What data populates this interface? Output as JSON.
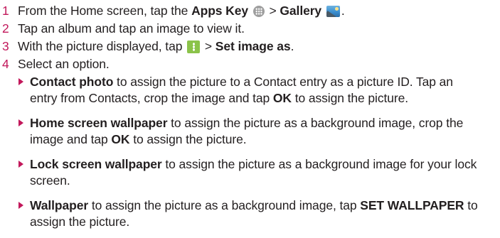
{
  "steps": [
    {
      "number": "1",
      "text_a": "From the Home screen, tap the ",
      "bold_a": "Apps Key",
      "text_b": " > ",
      "bold_b": "Gallery",
      "text_c": "."
    },
    {
      "number": "2",
      "text_a": "Tap an album and tap an image to view it."
    },
    {
      "number": "3",
      "text_a": "With the picture displayed, tap ",
      "text_b": " > ",
      "bold_b": "Set image as",
      "text_c": "."
    },
    {
      "number": "4",
      "text_a": "Select an option."
    }
  ],
  "options": [
    {
      "bold": "Contact photo",
      "line1": " to assign the picture to a Contact entry as a picture ID. Tap an",
      "line2_a": "entry from Contacts, crop the image and tap ",
      "line2_bold": "OK",
      "line2_b": " to assign the picture."
    },
    {
      "bold": "Home screen wallpaper",
      "line1": " to assign the picture as a background image, crop the",
      "line2_a": "image and tap ",
      "line2_bold": "OK",
      "line2_b": " to assign the picture."
    },
    {
      "bold": "Lock screen wallpaper",
      "line1": " to assign the picture as a background image for your lock",
      "line2_a": "screen."
    },
    {
      "bold": "Wallpaper",
      "line1_a": " to assign the picture as a background image,  tap ",
      "line1_bold": "SET WALLPAPER",
      "line1_b": " to",
      "line2_a": "assign the picture."
    }
  ],
  "icons": {
    "apps_key": "apps-key-icon",
    "gallery": "gallery-icon",
    "menu": "menu-icon"
  },
  "colors": {
    "accent": "#c2185b",
    "text": "#231f20"
  }
}
